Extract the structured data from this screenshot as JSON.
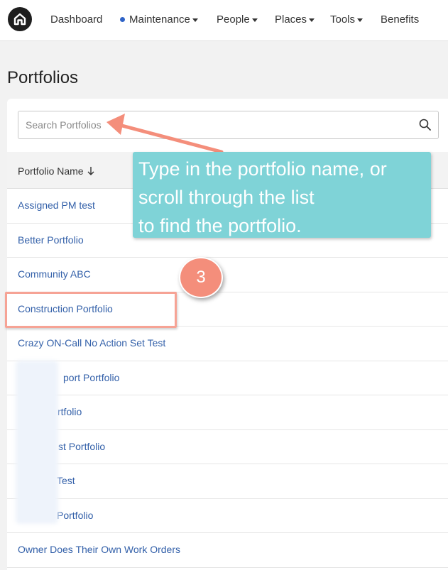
{
  "nav": {
    "items": [
      {
        "label": "Dashboard",
        "has_caret": false,
        "has_dot": false
      },
      {
        "label": "Maintenance",
        "has_caret": true,
        "has_dot": true
      },
      {
        "label": "People",
        "has_caret": true,
        "has_dot": false
      },
      {
        "label": "Places",
        "has_caret": true,
        "has_dot": false
      },
      {
        "label": "Tools",
        "has_caret": true,
        "has_dot": false
      },
      {
        "label": "Benefits",
        "has_caret": false,
        "has_dot": false
      }
    ],
    "logo_icon": "home-icon",
    "dot_color": "#2f63c7"
  },
  "page": {
    "title": "Portfolios"
  },
  "search": {
    "placeholder": "Search Portfolios",
    "value": "",
    "icon": "search-icon"
  },
  "table": {
    "column_header": "Portfolio Name",
    "sort_icon": "arrow-down-icon",
    "rows": [
      "Assigned PM test",
      "Better Portfolio",
      "Community ABC",
      "Construction Portfolio",
      "Crazy ON-Call No Action Set Test",
      "port Portfolio",
      "rtfolio",
      "st Portfolio",
      "Test",
      "Portfolio",
      "Owner Does Their Own Work Orders"
    ]
  },
  "annotation": {
    "callout_lines": [
      "Type in the portfolio name, or",
      "scroll through the list",
      "to find the portfolio."
    ],
    "step_number": "3",
    "colors": {
      "callout": "#7fd3d7",
      "badge": "#f48e7b",
      "highlight": "#f6a395",
      "link": "#3360a9"
    }
  }
}
